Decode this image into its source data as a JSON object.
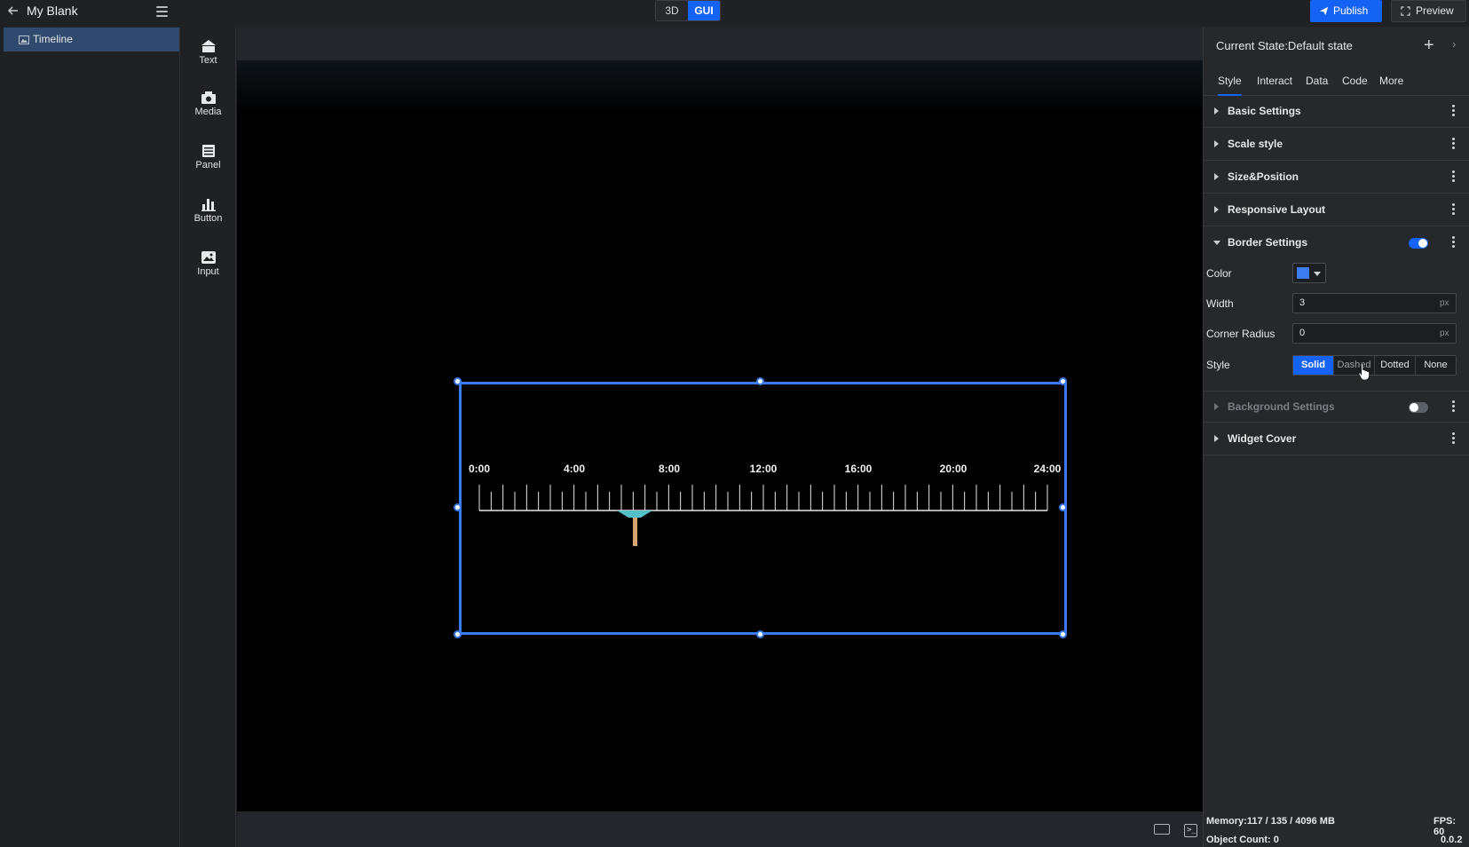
{
  "header": {
    "project_title": "My Blank",
    "mode_3d": "3D",
    "mode_gui": "GUI",
    "publish_label": "Publish",
    "preview_label": "Preview"
  },
  "layers": {
    "items": [
      {
        "label": "Timeline"
      }
    ]
  },
  "widgets": {
    "items": [
      {
        "label": "Text",
        "icon": "text-widget-icon"
      },
      {
        "label": "Media",
        "icon": "media-widget-icon"
      },
      {
        "label": "Panel",
        "icon": "panel-widget-icon"
      },
      {
        "label": "Button",
        "icon": "button-widget-icon"
      },
      {
        "label": "Input",
        "icon": "input-widget-icon"
      }
    ]
  },
  "canvas": {
    "timeline_labels": [
      "0:00",
      "4:00",
      "8:00",
      "12:00",
      "16:00",
      "20:00",
      "24:00"
    ],
    "accent_color": "#3b7cf0"
  },
  "properties": {
    "current_state": "Current State:Default state",
    "tabs": [
      "Style",
      "Interact",
      "Data",
      "Code",
      "More"
    ],
    "sections": {
      "basic": "Basic Settings",
      "scale": "Scale style",
      "size": "Size&Position",
      "responsive": "Responsive Layout",
      "border": "Border Settings",
      "background": "Background Settings",
      "cover": "Widget Cover"
    },
    "border": {
      "color_label": "Color",
      "color_value": "#3b7cf0",
      "width_label": "Width",
      "width_value": "3",
      "width_unit": "px",
      "radius_label": "Corner Radius",
      "radius_value": "0",
      "radius_unit": "px",
      "style_label": "Style",
      "style_options": [
        "Solid",
        "Dashed",
        "Dotted",
        "None"
      ],
      "style_selected": "Solid"
    }
  },
  "status": {
    "memory": "Memory:117 / 135 / 4096 MB",
    "object_count": "Object Count: 0",
    "fps": "FPS: 60",
    "version": "0.0.2"
  }
}
